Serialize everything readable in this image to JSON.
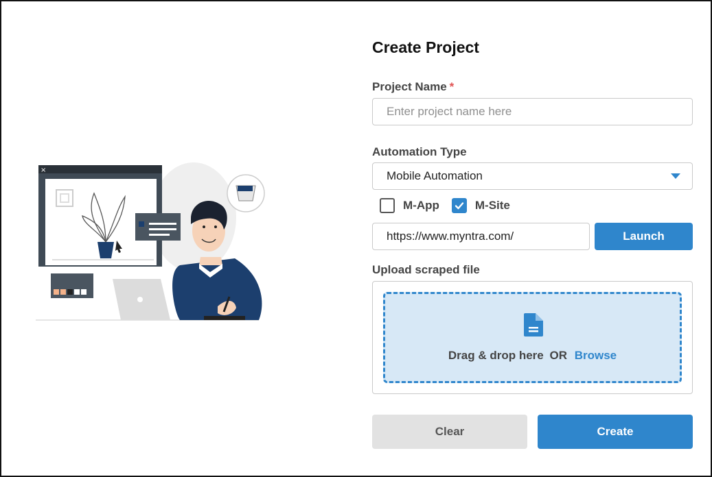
{
  "form": {
    "title": "Create Project",
    "project_name": {
      "label": "Project Name",
      "required_mark": "*",
      "placeholder": "Enter project name here",
      "value": ""
    },
    "automation_type": {
      "label": "Automation Type",
      "selected": "Mobile Automation"
    },
    "checkboxes": [
      {
        "label": "M-App",
        "checked": false
      },
      {
        "label": "M-Site",
        "checked": true
      }
    ],
    "url": {
      "value": "https://www.myntra.com/"
    },
    "launch_label": "Launch",
    "upload": {
      "label": "Upload scraped file",
      "drop_text": "Drag & drop here",
      "or_text": "OR",
      "browse_label": "Browse",
      "icon": "document-icon"
    },
    "clear_label": "Clear",
    "create_label": "Create"
  },
  "colors": {
    "primary": "#2f86cc",
    "dropzone_bg": "#d7e8f6",
    "required": "#e05252",
    "illustration_navy": "#1c3f6e"
  }
}
